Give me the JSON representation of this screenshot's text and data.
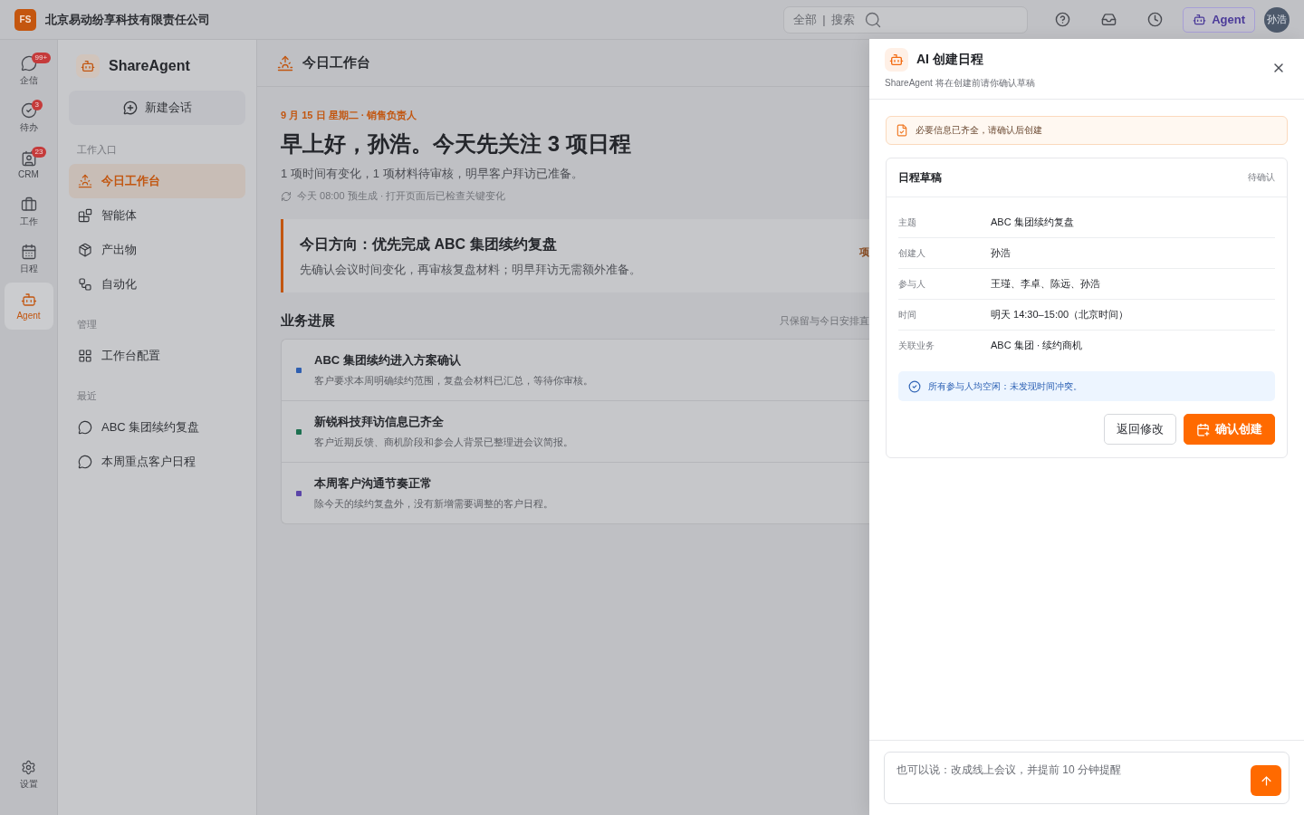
{
  "top_bar": {
    "logo": "FS",
    "company": "北京易动纷享科技有限责任公司",
    "search": {
      "scope": "全部",
      "separator": "|",
      "placeholder": "搜索"
    },
    "agent_button": "Agent",
    "avatar": "孙浩"
  },
  "rail": {
    "items": [
      {
        "label": "企信",
        "badge": "99+",
        "selected": false
      },
      {
        "label": "待办",
        "badge": "3",
        "selected": false
      },
      {
        "label": "CRM",
        "badge": "23",
        "selected": false
      },
      {
        "label": "工作",
        "selected": false
      },
      {
        "label": "日程",
        "selected": false
      },
      {
        "label": "Agent",
        "selected": true
      }
    ],
    "settings": "设置"
  },
  "sidebar": {
    "title": "ShareAgent",
    "new_chat": "新建会话",
    "sections": [
      {
        "heading": "工作入口",
        "items": [
          {
            "label": "今日工作台",
            "selected": true
          },
          {
            "label": "智能体",
            "selected": false
          },
          {
            "label": "产出物",
            "selected": false
          },
          {
            "label": "自动化",
            "selected": false
          }
        ]
      },
      {
        "heading": "管理",
        "items": [
          {
            "label": "工作台配置",
            "selected": false
          }
        ]
      },
      {
        "heading": "最近",
        "items": [
          {
            "label": "ABC 集团续约复盘",
            "selected": false
          },
          {
            "label": "本周重点客户日程",
            "selected": false
          }
        ]
      }
    ]
  },
  "main": {
    "header": "今日工作台",
    "date_line": "9 月 15 日 星期二 · 销售负责人",
    "greeting": "早上好，孙浩。今天先关注 3 项日程",
    "summary": "1 项时间有变化，1 项材料待审核，明早客户拜访已准备。",
    "refresh_note": "今天 08:00 预生成 · 打开页面后已检查关键变化",
    "direction": {
      "title": "今日方向：优先完成 ABC 集团续约复盘",
      "text": "先确认会议时间变化，再审核复盘材料；明早拜访无需额外准备。",
      "side": "项"
    },
    "progress": {
      "title": "业务进展",
      "note": "只保留与今日安排直",
      "items": [
        {
          "title": "ABC 集团续约进入方案确认",
          "text": "客户要求本周明确续约范围，复盘会材料已汇总，等待你审核。",
          "color": "#2f5fb0"
        },
        {
          "title": "新锐科技拜访信息已齐全",
          "text": "客户近期反馈、商机阶段和参会人背景已整理进会议简报。",
          "color": "#1d7050"
        },
        {
          "title": "本周客户沟通节奏正常",
          "text": "除今天的续约复盘外，没有新增需要调整的客户日程。",
          "color": "#5b45a8"
        }
      ]
    }
  },
  "drawer": {
    "title": "AI 创建日程",
    "subtitle": "ShareAgent 将在创建前请你确认草稿",
    "notice": "必要信息已齐全，请确认后创建",
    "draft": {
      "title": "日程草稿",
      "status": "待确认",
      "fields": [
        {
          "label": "主题",
          "value": "ABC 集团续约复盘"
        },
        {
          "label": "创建人",
          "value": "孙浩"
        },
        {
          "label": "参与人",
          "value": "王瑾、李卓、陈远、孙浩"
        },
        {
          "label": "时间",
          "value": "明天 14:30–15:00（北京时间）"
        },
        {
          "label": "关联业务",
          "value": "ABC 集团 · 续约商机"
        }
      ],
      "check": "所有参与人均空闲：未发现时间冲突。",
      "buttons": [
        {
          "label": "返回修改",
          "kind": "secondary"
        },
        {
          "label": "确认创建",
          "kind": "primary"
        }
      ]
    },
    "composer": {
      "placeholder": "也可以说：改成线上会议，并提前 10 分钟提醒"
    }
  }
}
